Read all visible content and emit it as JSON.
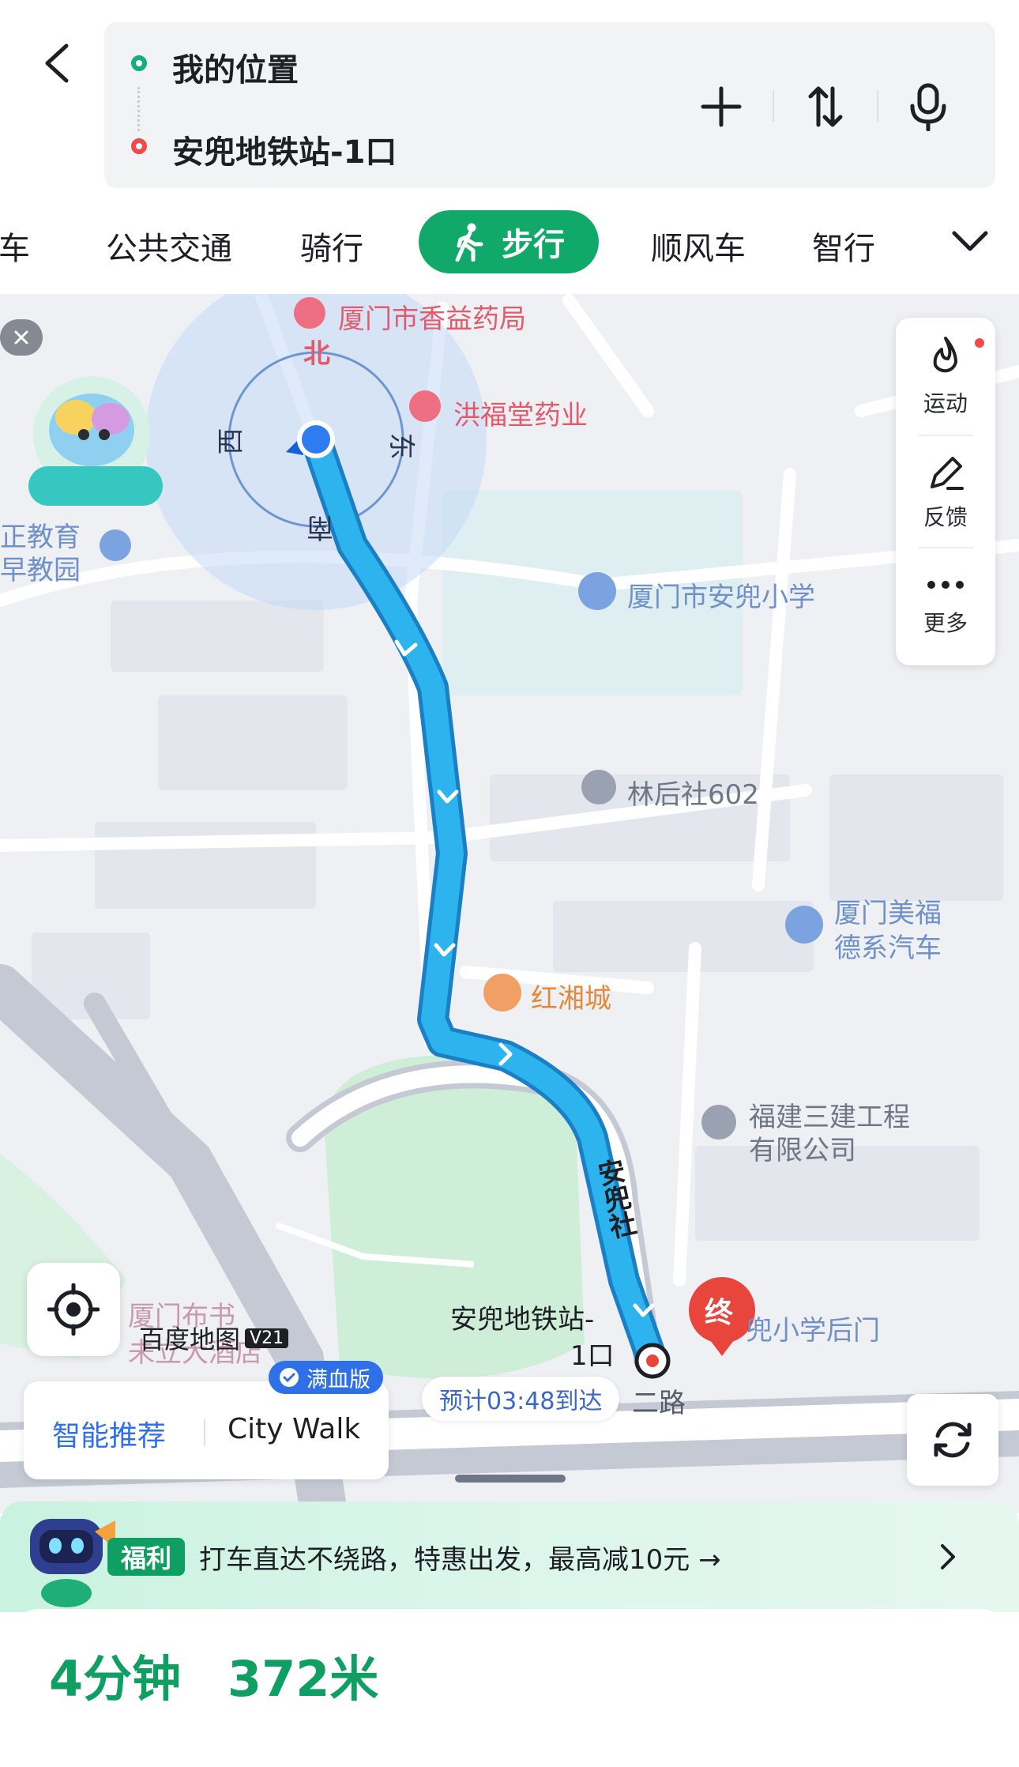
{
  "search": {
    "origin": "我的位置",
    "destination": "安兜地铁站-1口"
  },
  "icons": {
    "back": "back-arrow-icon",
    "add": "plus-icon",
    "swap": "swap-icon",
    "voice": "microphone-icon"
  },
  "modes": {
    "items": [
      "驾车",
      "公共交通",
      "骑行",
      "步行",
      "顺风车",
      "智行"
    ],
    "active": "步行"
  },
  "compass": {
    "north": "北",
    "south": "南",
    "east": "东",
    "west": "西"
  },
  "pois": {
    "pharmacy1": "厦门市香益药局",
    "pharmacy2": "洪福堂药业",
    "school": "厦门市安兜小学",
    "community": "林后社602",
    "car_dealer_line1": "厦门美福",
    "car_dealer_line2": "德系汽车",
    "restaurant": "红湘城",
    "company_line1": "福建三建工程",
    "company_line2": "有限公司",
    "kindergarten_line1": "正教育",
    "kindergarten_line2": "早教园",
    "back_gate": "兜小学后门",
    "bookstore_line1": "厦门布书",
    "bookstore_line2": "未立大酒店",
    "metro_line1": "安兜地铁站-",
    "metro_line2": "1口",
    "road_name": "安兜社",
    "road_bottom": "二路"
  },
  "side_tools": {
    "sport": "运动",
    "feedback": "反馈",
    "more": "更多"
  },
  "end_marker": "终",
  "watermark": "百度地图",
  "watermark_version": "V21",
  "badge": "满血版",
  "smart": {
    "recommend": "智能推荐",
    "citywalk": "City Walk"
  },
  "eta": "预计03:48到达",
  "promo": {
    "tag": "福利",
    "text": "打车直达不绕路，特惠出发，最高减10元 →"
  },
  "summary": {
    "time": "4分钟",
    "distance": "372米"
  },
  "colors": {
    "brand_green": "#11a96a",
    "route_blue": "#1ea8e6",
    "end_red": "#e8453c"
  }
}
